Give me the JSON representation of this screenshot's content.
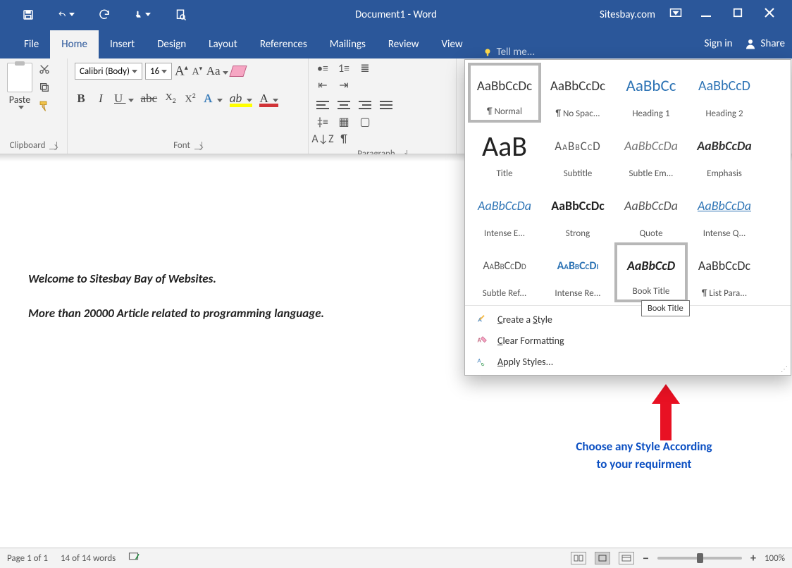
{
  "titlebar": {
    "doc_title": "Document1 - Word",
    "site": "Sitesbay.com"
  },
  "tabs": {
    "file": "File",
    "home": "Home",
    "insert": "Insert",
    "design": "Design",
    "layout": "Layout",
    "references": "References",
    "mailings": "Mailings",
    "review": "Review",
    "view": "View",
    "tellme": "Tell me..."
  },
  "account": {
    "signin": "Sign in",
    "share": "Share"
  },
  "ribbon": {
    "clipboard": {
      "paste": "Paste",
      "label": "Clipboard"
    },
    "font": {
      "name": "Calibri (Body)",
      "size": "16",
      "label": "Font"
    },
    "paragraph": {
      "label": "Paragraph"
    }
  },
  "styles": {
    "items": [
      {
        "preview": "AaBbCcDc",
        "name": "¶ Normal",
        "css": "font-size:19px;color:#333;"
      },
      {
        "preview": "AaBbCcDc",
        "name": "¶ No Spac...",
        "css": "font-size:19px;color:#333;"
      },
      {
        "preview": "AaBbCc",
        "name": "Heading 1",
        "css": "font-size:23px;color:#2e74b5;"
      },
      {
        "preview": "AaBbCcD",
        "name": "Heading 2",
        "css": "font-size:20px;color:#2e74b5;"
      },
      {
        "preview": "AaB",
        "name": "Title",
        "css": "font-size:40px;color:#222;font-weight:300;"
      },
      {
        "preview": "AaBbCcD",
        "name": "Subtitle",
        "css": "font-size:17px;color:#555;letter-spacing:1px;font-variant:small-caps;"
      },
      {
        "preview": "AaBbCcDa",
        "name": "Subtle Em...",
        "css": "font-size:18px;color:#777;font-style:italic;"
      },
      {
        "preview": "AaBbCcDa",
        "name": "Emphasis",
        "css": "font-size:18px;color:#333;font-style:italic;font-weight:600;"
      },
      {
        "preview": "AaBbCcDa",
        "name": "Intense E...",
        "css": "font-size:18px;color:#2e74b5;font-style:italic;"
      },
      {
        "preview": "AaBbCcDc",
        "name": "Strong",
        "css": "font-size:18px;color:#222;font-weight:700;"
      },
      {
        "preview": "AaBbCcDa",
        "name": "Quote",
        "css": "font-size:18px;color:#555;font-style:italic;"
      },
      {
        "preview": "AaBbCcDa",
        "name": "Intense Q...",
        "css": "font-size:18px;color:#2e74b5;font-style:italic;text-decoration:underline;"
      },
      {
        "preview": "AaBbCcDd",
        "name": "Subtle Ref...",
        "css": "font-size:16px;color:#555;font-variant:small-caps;"
      },
      {
        "preview": "AaBbCcDi",
        "name": "Intense Re...",
        "css": "font-size:16px;color:#2e74b5;font-variant:small-caps;font-weight:600;"
      },
      {
        "preview": "AaBbCcD",
        "name": "Book Title",
        "css": "font-size:18px;color:#222;font-style:italic;font-weight:700;"
      },
      {
        "preview": "AaBbCcDc",
        "name": "¶ List Para...",
        "css": "font-size:18px;color:#333;"
      }
    ],
    "menu": {
      "create": "Create a Style",
      "clear": "Clear Formatting",
      "apply": "Apply Styles..."
    },
    "tooltip": "Book Title"
  },
  "document": {
    "line1": "Welcome to Sitesbay Bay of Websites.",
    "line2": "More than 20000 Article related to programming language."
  },
  "annotation": {
    "text1": "Choose any Style According",
    "text2": "to your requirment"
  },
  "status": {
    "page": "Page 1 of 1",
    "words": "14 of 14 words",
    "zoom": "100%"
  }
}
